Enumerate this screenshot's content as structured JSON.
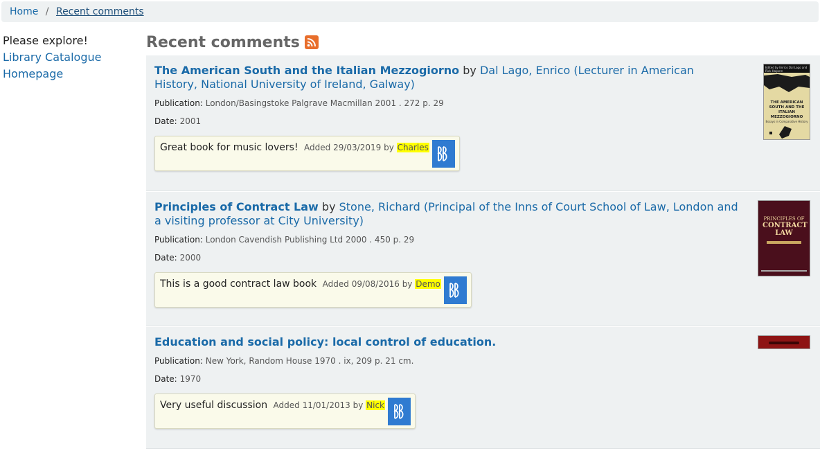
{
  "breadcrumb": {
    "home": "Home",
    "separator": "/",
    "current": "Recent comments"
  },
  "sidebar": {
    "intro": "Please explore!",
    "links": [
      "Library Catalogue",
      "Homepage"
    ]
  },
  "page": {
    "title": "Recent comments",
    "rss_icon": "rss-icon"
  },
  "labels": {
    "by": "by",
    "publication": "Publication:",
    "date": "Date:",
    "added": "Added",
    "added_by": "by"
  },
  "items": [
    {
      "title": "The American South and the Italian Mezzogiorno",
      "author": "Dal Lago, Enrico (Lecturer in American History, National University of Ireland, Galway)",
      "publication": "London/Basingstoke Palgrave Macmillan 2001 . 272 p. 29",
      "date": "2001",
      "comment": "Great book for music lovers!",
      "comment_date": "29/03/2019",
      "commenter": "Charles",
      "cover": {
        "top_text": "Edited by Enrico Dal Lago and Rick Halpern",
        "title": "THE AMERICAN SOUTH AND THE ITALIAN MEZZOGIORNO",
        "sub": "Essays in Comparative History"
      }
    },
    {
      "title": "Principles of Contract Law",
      "author": "Stone, Richard (Principal of the Inns of Court School of Law, London and a visiting professor at City University)",
      "publication": "London Cavendish Publishing Ltd 2000 . 450 p. 29",
      "date": "2000",
      "comment": "This is a good contract law book",
      "comment_date": "09/08/2016",
      "commenter": "Demo",
      "cover": {
        "top_text": "PRINCIPLES OF",
        "title": "CONTRACT LAW"
      }
    },
    {
      "title": "Education and social policy: local control of education.",
      "author": "",
      "publication": "New York, Random House 1970 . ix, 209 p. 21 cm.",
      "date": "1970",
      "comment": "Very useful discussion",
      "comment_date": "11/01/2013",
      "commenter": "Nick"
    }
  ],
  "colors": {
    "link": "#1a6aa8",
    "item_bg": "#eef1f2",
    "highlight": "#ffff00",
    "avatar": "#2f7bd1",
    "rss": "#e86e2b"
  }
}
